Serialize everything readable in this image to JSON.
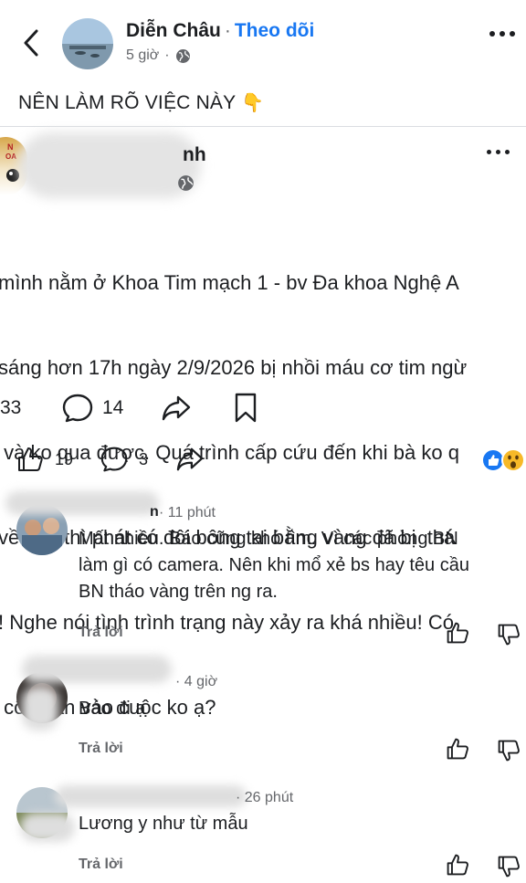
{
  "header": {
    "page_name": "Diễn Châu",
    "separator": "·",
    "follow_label": "Theo dõi",
    "time": "5 giờ",
    "separator2": "·"
  },
  "post": {
    "caption": "NÊN LÀM RÕ VIỆC NÀY",
    "caption_emoji": "👇"
  },
  "shared_post": {
    "name_visible": "nh",
    "body_lines": [
      "mình nằm ở Khoa Tim mạch 1 - bv Đa khoa Nghệ A",
      "sáng hơn 17h ngày 2/9/2026 bị nhồi máu cơ tim ngừ",
      " và ko qua được. Quá trình cấp cứu đến khi bà ko q",
      "về nhà thì phát có đôi bông tai bằng vàng đã bị  thá",
      "! Nghe nói tình trình trạng này xảy ra khá nhiều! Có",
      " công an vào cuộc ko ạ?"
    ],
    "likes": "33",
    "comments": "14"
  },
  "post_actions": {
    "likes": "19",
    "comments": "3"
  },
  "comments": [
    {
      "name_visible": "n",
      "time": "· 11 phút",
      "text_lines": [
        "Mất nhiều. Báo cũng khó tìm. Vì các phòng BN",
        "làm gì có camera. Nên khi mổ xẻ bs hay têu cầu",
        "BN tháo vàng trên ng ra."
      ],
      "reply_label": "Trả lời"
    },
    {
      "name_visible": "",
      "time": "· 4 giờ",
      "text_lines": [
        "Báo đi ạ"
      ],
      "reply_label": "Trả lời"
    },
    {
      "name_visible": "",
      "time": "· 26 phút",
      "text_lines": [
        "Lương y như từ mẫu"
      ],
      "reply_label": "Trả lời"
    }
  ],
  "colors": {
    "accent": "#1877f2",
    "muted": "#65676b"
  }
}
